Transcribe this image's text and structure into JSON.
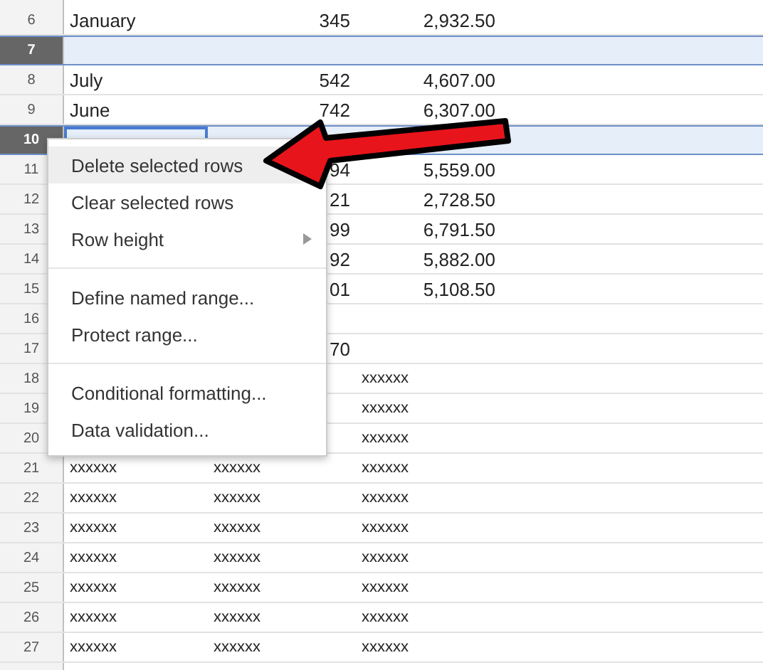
{
  "rows": [
    {
      "number": "6",
      "kind": "figures",
      "selected": false,
      "cursor": false,
      "column_1": "January",
      "column_2": "345",
      "column_3": "2,932.50"
    },
    {
      "number": "7",
      "kind": "figures",
      "selected": true,
      "cursor": false
    },
    {
      "number": "8",
      "kind": "figures",
      "selected": false,
      "cursor": false,
      "column_1": "July",
      "column_2": "542",
      "column_3": "4,607.00"
    },
    {
      "number": "9",
      "kind": "figures",
      "selected": false,
      "cursor": false,
      "column_1": "June",
      "column_2": "742",
      "column_3": "6,307.00"
    },
    {
      "number": "10",
      "kind": "figures",
      "selected": true,
      "cursor": true
    },
    {
      "number": "11",
      "kind": "figures",
      "selected": false,
      "cursor": false,
      "column_2": "94",
      "column_3": "5,559.00"
    },
    {
      "number": "12",
      "kind": "figures",
      "selected": false,
      "cursor": false,
      "column_2": "21",
      "column_3": "2,728.50"
    },
    {
      "number": "13",
      "kind": "figures",
      "selected": false,
      "cursor": false,
      "column_2": "99",
      "column_3": "6,791.50"
    },
    {
      "number": "14",
      "kind": "figures",
      "selected": false,
      "cursor": false,
      "column_2": "92",
      "column_3": "5,882.00"
    },
    {
      "number": "15",
      "kind": "figures",
      "selected": false,
      "cursor": false,
      "column_2": "01",
      "column_3": "5,108.50"
    },
    {
      "number": "16",
      "kind": "figures",
      "selected": false,
      "cursor": false
    },
    {
      "number": "17",
      "kind": "figures",
      "selected": false,
      "cursor": false,
      "column_2": "70"
    },
    {
      "number": "18",
      "kind": "text",
      "selected": false,
      "cursor": false,
      "column_3": "xxxxxx"
    },
    {
      "number": "19",
      "kind": "text",
      "selected": false,
      "cursor": false,
      "column_3": "xxxxxx"
    },
    {
      "number": "20",
      "kind": "text",
      "selected": false,
      "cursor": false,
      "column_3": "xxxxxx"
    },
    {
      "number": "21",
      "kind": "text",
      "selected": false,
      "cursor": false,
      "column_1": "xxxxxx",
      "column_2": "xxxxxx",
      "column_3": "xxxxxx"
    },
    {
      "number": "22",
      "kind": "text",
      "selected": false,
      "cursor": false,
      "column_1": "xxxxxx",
      "column_2": "xxxxxx",
      "column_3": "xxxxxx"
    },
    {
      "number": "23",
      "kind": "text",
      "selected": false,
      "cursor": false,
      "column_1": "xxxxxx",
      "column_2": "xxxxxx",
      "column_3": "xxxxxx"
    },
    {
      "number": "24",
      "kind": "text",
      "selected": false,
      "cursor": false,
      "column_1": "xxxxxx",
      "column_2": "xxxxxx",
      "column_3": "xxxxxx"
    },
    {
      "number": "25",
      "kind": "text",
      "selected": false,
      "cursor": false,
      "column_1": "xxxxxx",
      "column_2": "xxxxxx",
      "column_3": "xxxxxx"
    },
    {
      "number": "26",
      "kind": "text",
      "selected": false,
      "cursor": false,
      "column_1": "xxxxxx",
      "column_2": "xxxxxx",
      "column_3": "xxxxxx"
    },
    {
      "number": "27",
      "kind": "text",
      "selected": false,
      "cursor": false,
      "column_1": "xxxxxx",
      "column_2": "xxxxxx",
      "column_3": "xxxxxx"
    }
  ],
  "context_menu": {
    "items": [
      {
        "kind": "item",
        "label": "Delete selected rows",
        "highlighted": true
      },
      {
        "kind": "item",
        "label": "Clear selected rows",
        "highlighted": false
      },
      {
        "kind": "submenu",
        "label": "Row height",
        "highlighted": false
      },
      {
        "kind": "separator"
      },
      {
        "kind": "item",
        "label": "Define named range...",
        "highlighted": false
      },
      {
        "kind": "item",
        "label": "Protect range...",
        "highlighted": false
      },
      {
        "kind": "separator"
      },
      {
        "kind": "item",
        "label": "Conditional formatting...",
        "highlighted": false
      },
      {
        "kind": "item",
        "label": "Data validation...",
        "highlighted": false
      }
    ]
  }
}
